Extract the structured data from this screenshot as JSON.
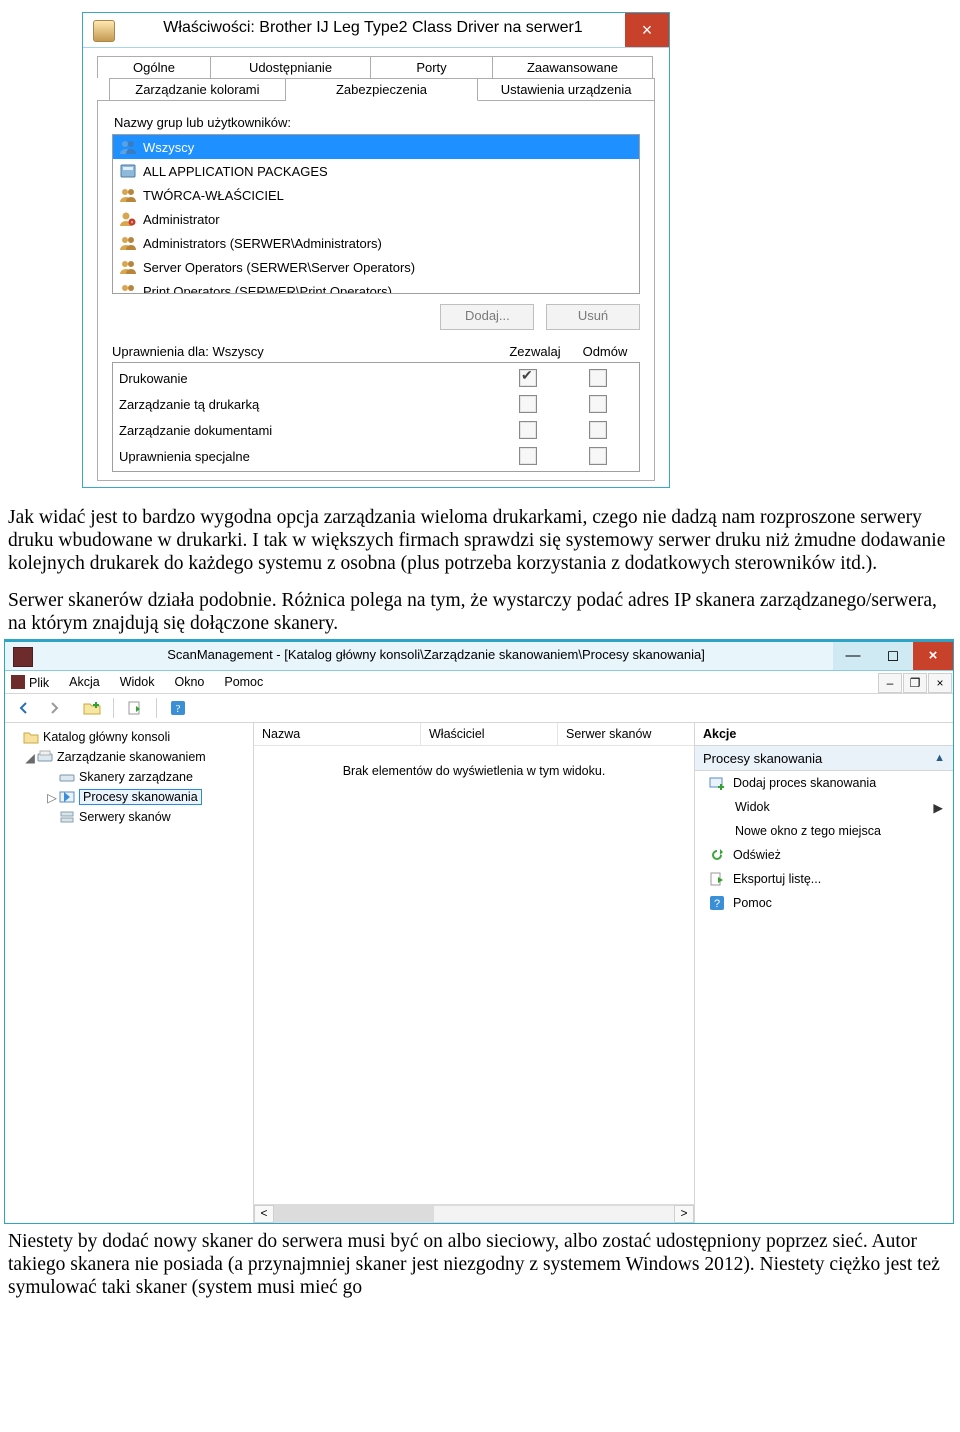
{
  "dlg": {
    "title": "Właściwości: Brother IJ Leg Type2 Class Driver na serwer1",
    "tabs": {
      "general": "Ogólne",
      "sharing": "Udostępnianie",
      "ports": "Porty",
      "advanced": "Zaawansowane",
      "color": "Zarządzanie kolorami",
      "security": "Zabezpieczenia",
      "device": "Ustawienia urządzenia"
    },
    "groups_label": "Nazwy grup lub użytkowników:",
    "groups": {
      "i0": "Wszyscy",
      "i1": "ALL APPLICATION PACKAGES",
      "i2": "TWÓRCA-WŁAŚCICIEL",
      "i3": "Administrator",
      "i4": "Administrators (SERWER\\Administrators)",
      "i5": "Server Operators (SERWER\\Server Operators)",
      "i6": "Print Operators (SERWER\\Print Operators)"
    },
    "add_btn": "Dodaj...",
    "remove_btn": "Usuń",
    "perm_header": {
      "title": "Uprawnienia dla: Wszyscy",
      "allow": "Zezwalaj",
      "deny": "Odmów"
    },
    "perms": {
      "p0": "Drukowanie",
      "p1": "Zarządzanie tą drukarką",
      "p2": "Zarządzanie dokumentami",
      "p3": "Uprawnienia specjalne"
    }
  },
  "para1": "Jak widać jest to bardzo wygodna opcja zarządzania wieloma drukarkami, czego nie dadzą nam rozproszone serwery druku wbudowane w drukarki. I tak w większych firmach sprawdzi się systemowy serwer druku niż żmudne dodawanie kolejnych drukarek do każdego systemu z osobna (plus potrzeba korzystania z dodatkowych sterowników itd.).",
  "para2": "Serwer skanerów działa podobnie. Różnica polega na tym, że wystarczy podać adres IP skanera zarządzanego/serwera, na którym znajdują się dołączone skanery.",
  "mmc": {
    "title": "ScanManagement - [Katalog główny konsoli\\Zarządzanie skanowaniem\\Procesy skanowania]",
    "menu": {
      "file": "Plik",
      "action": "Akcja",
      "view": "Widok",
      "window": "Okno",
      "help": "Pomoc"
    },
    "tree": {
      "root": "Katalog główny konsoli",
      "n1": "Zarządzanie skanowaniem",
      "n2": "Skanery zarządzane",
      "n3": "Procesy skanowania",
      "n4": "Serwery skanów"
    },
    "mid": {
      "c_name": "Nazwa",
      "c_owner": "Właściciel",
      "c_server": "Serwer skanów",
      "empty": "Brak elementów do wyświetlenia w tym widoku."
    },
    "act": {
      "header": "Akcje",
      "section": "Procesy skanowania",
      "a_add": "Dodaj proces skanowania",
      "a_view": "Widok",
      "a_newwin": "Nowe okno z tego miejsca",
      "a_refresh": "Odśwież",
      "a_export": "Eksportuj listę...",
      "a_help": "Pomoc"
    }
  },
  "para3": "Niestety by dodać nowy skaner do serwera musi być on albo sieciowy, albo zostać udostępniony poprzez sieć. Autor takiego skanera nie posiada (a przynajmniej skaner jest niezgodny z systemem Windows 2012). Niestety ciężko jest też symulować taki skaner (system musi mieć go"
}
